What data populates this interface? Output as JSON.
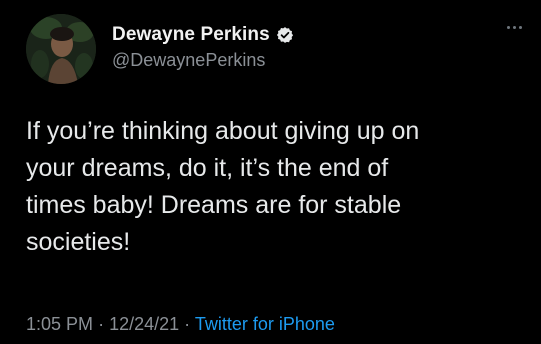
{
  "author": {
    "display_name": "Dewayne Perkins",
    "handle": "@DewaynePerkins",
    "verified": true
  },
  "tweet": {
    "text": "If you’re thinking about giving up on\nyour dreams, do it, it’s the end of\ntimes baby! Dreams are for stable\nsocieties!",
    "time": "1:05 PM",
    "separator": "·",
    "date": "12/24/21",
    "source": "Twitter for iPhone"
  },
  "icons": {
    "verified": "verified-badge-icon",
    "more": "more-options-icon"
  },
  "colors": {
    "background": "#000000",
    "text": "#e7e9ea",
    "secondary": "#8b9096",
    "link": "#1d9bf0"
  }
}
